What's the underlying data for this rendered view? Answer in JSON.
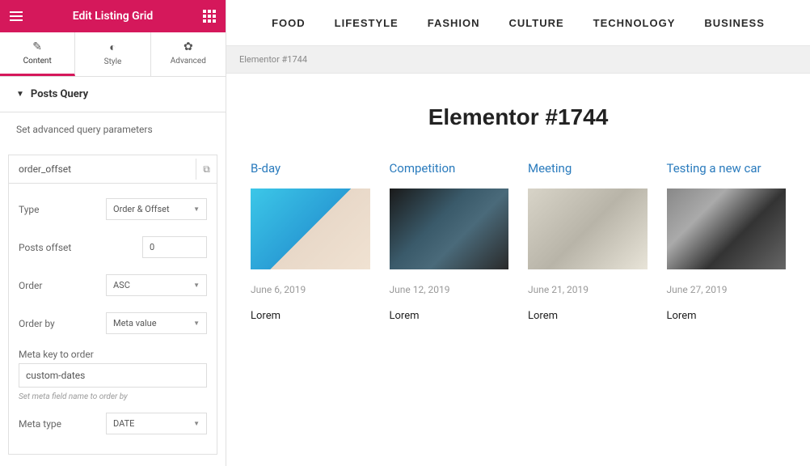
{
  "header": {
    "title": "Edit Listing Grid"
  },
  "tabs": [
    {
      "label": "Content",
      "active": true
    },
    {
      "label": "Style",
      "active": false
    },
    {
      "label": "Advanced",
      "active": false
    }
  ],
  "section": {
    "title": "Posts Query",
    "desc": "Set advanced query parameters"
  },
  "query": {
    "name": "order_offset",
    "type_label": "Type",
    "type_value": "Order & Offset",
    "offset_label": "Posts offset",
    "offset_value": "0",
    "order_label": "Order",
    "order_value": "ASC",
    "orderby_label": "Order by",
    "orderby_value": "Meta value",
    "metakey_label": "Meta key to order",
    "metakey_value": "custom-dates",
    "metakey_hint": "Set meta field name to order by",
    "metatype_label": "Meta type",
    "metatype_value": "DATE"
  },
  "nav": [
    "FOOD",
    "LIFESTYLE",
    "FASHION",
    "CULTURE",
    "TECHNOLOGY",
    "BUSINESS"
  ],
  "breadcrumb": "Elementor #1744",
  "page_title": "Elementor #1744",
  "cards": [
    {
      "title": "B-day",
      "date": "June 6, 2019",
      "text": "Lorem"
    },
    {
      "title": "Competition",
      "date": "June 12, 2019",
      "text": "Lorem"
    },
    {
      "title": "Meeting",
      "date": "June 21, 2019",
      "text": "Lorem"
    },
    {
      "title": "Testing a new car",
      "date": "June 27, 2019",
      "text": "Lorem"
    }
  ]
}
